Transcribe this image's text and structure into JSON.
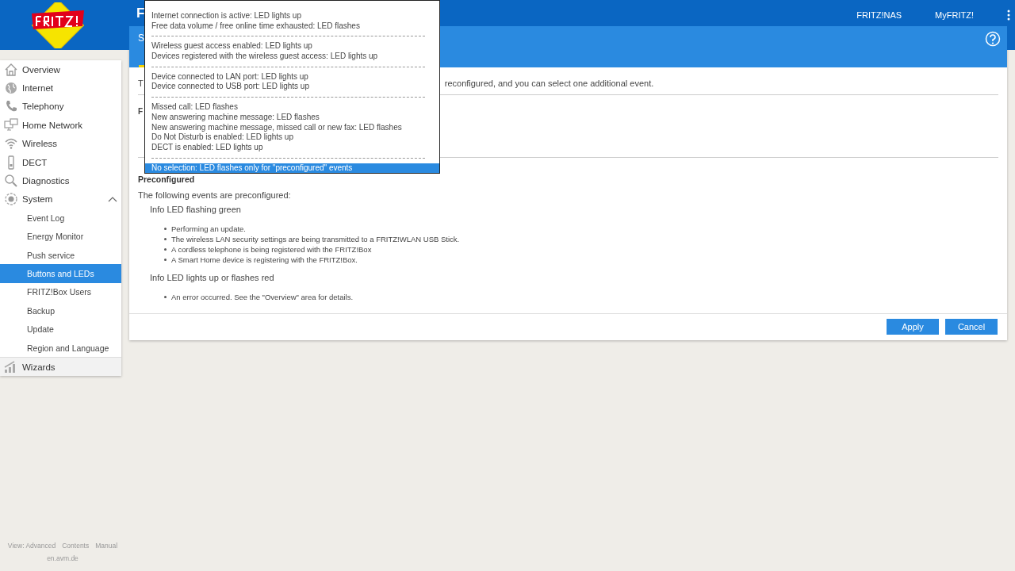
{
  "header": {
    "title_fragment": "F",
    "links": [
      "FRITZ!NAS",
      "MyFRITZ!"
    ]
  },
  "page_bar": {
    "title_fragment": "S"
  },
  "sidebar": {
    "items": [
      {
        "label": "Overview",
        "selected": false
      },
      {
        "label": "Internet",
        "selected": false
      },
      {
        "label": "Telephony",
        "selected": false
      },
      {
        "label": "Home Network",
        "selected": false
      },
      {
        "label": "Wireless",
        "selected": false
      },
      {
        "label": "DECT",
        "selected": false
      },
      {
        "label": "Diagnostics",
        "selected": false
      },
      {
        "label": "System",
        "selected": false,
        "expanded": true,
        "children": [
          {
            "label": "Event Log",
            "selected": false
          },
          {
            "label": "Energy Monitor",
            "selected": false
          },
          {
            "label": "Push service",
            "selected": false
          },
          {
            "label": "Buttons and LEDs",
            "selected": true
          },
          {
            "label": "FRITZ!Box Users",
            "selected": false
          },
          {
            "label": "Backup",
            "selected": false
          },
          {
            "label": "Update",
            "selected": false
          },
          {
            "label": "Region and Language",
            "selected": false
          }
        ]
      }
    ],
    "wizards": "Wizards"
  },
  "content": {
    "intro_start": "T",
    "intro_end": "reconfigured, and you can select one additional event.",
    "section_fragment": "F",
    "preconfigured": {
      "heading": "Preconfigured",
      "intro": "The following events are preconfigured:",
      "groups": [
        {
          "title": "Info LED flashing green",
          "items": [
            "Performing an update.",
            "The wireless LAN security settings are being transmitted to a FRITZ!WLAN USB Stick.",
            "A cordless telephone is being registered with the FRITZ!Box",
            "A Smart Home device is registering with the FRITZ!Box."
          ]
        },
        {
          "title": "Info LED lights up or flashes red",
          "items": [
            "An error occurred. See the \"Overview\" area for details."
          ]
        }
      ]
    },
    "buttons": [
      "Apply",
      "Cancel"
    ]
  },
  "dropdown": {
    "groups": [
      [
        {
          "label": "Internet connection is active: LED lights up",
          "selected": false
        },
        {
          "label": "Free data volume / free online time exhausted: LED flashes",
          "selected": false
        }
      ],
      [
        {
          "label": "Wireless guest access enabled: LED lights up",
          "selected": false
        },
        {
          "label": "Devices registered with the wireless guest access: LED lights up",
          "selected": false
        }
      ],
      [
        {
          "label": "Device connected to LAN port: LED lights up",
          "selected": false
        },
        {
          "label": "Device connected to USB port: LED lights up",
          "selected": false
        }
      ],
      [
        {
          "label": "Missed call: LED flashes",
          "selected": false
        },
        {
          "label": "New answering machine message: LED flashes",
          "selected": false
        },
        {
          "label": "New answering machine message, missed call or new fax: LED flashes",
          "selected": false
        },
        {
          "label": "Do Not Disturb is enabled: LED lights up",
          "selected": false
        },
        {
          "label": "DECT is enabled: LED lights up",
          "selected": false
        }
      ],
      [
        {
          "label": "No selection: LED flashes only for \"preconfigured\" events",
          "selected": true
        }
      ]
    ]
  },
  "footer": {
    "links": [
      "View: Advanced",
      "Contents",
      "Manual"
    ],
    "site": "en.avm.de"
  }
}
